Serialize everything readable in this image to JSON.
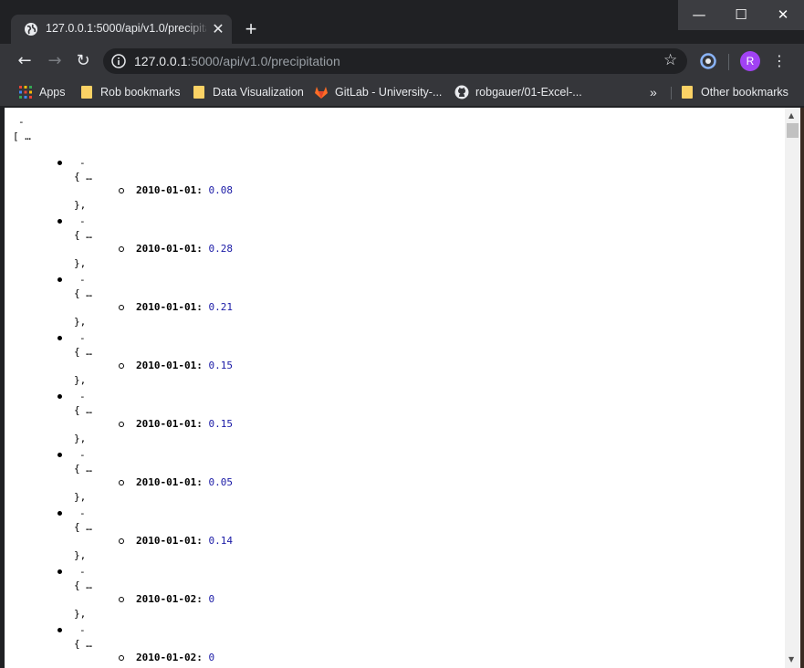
{
  "browser": {
    "tab": {
      "title": "127.0.0.1:5000/api/v1.0/precipitation",
      "close": "✕"
    },
    "new_tab": "+",
    "window": {
      "minimize": "—",
      "maximize": "☐",
      "close": "✕"
    },
    "nav": {
      "back": "←",
      "forward": "→",
      "reload": "↻"
    },
    "url": {
      "host": "127.0.0.1",
      "rest": ":5000/api/v1.0/precipitation"
    },
    "star": "☆",
    "avatar": "R",
    "menu": "⋮"
  },
  "bookmarks": {
    "items": [
      {
        "label": "Apps",
        "icon": "apps-grid-icon"
      },
      {
        "label": "Rob bookmarks",
        "icon": "folder-icon"
      },
      {
        "label": "Data Visualization",
        "icon": "folder-icon"
      },
      {
        "label": "GitLab - University-...",
        "icon": "gitlab-icon"
      },
      {
        "label": "robgauer/01-Excel-...",
        "icon": "github-icon"
      }
    ],
    "overflow": "»",
    "other": "Other bookmarks"
  },
  "colors": {
    "number": "#1a1aa6",
    "folder": "#fbd265",
    "avatar": "#a142f4"
  },
  "page": {
    "root_collapse": "-",
    "root_open": "[ …",
    "item_collapse": "-",
    "item_open": "{ …",
    "item_close": "},",
    "entries": [
      {
        "date": "2010-01-01",
        "value": "0.08"
      },
      {
        "date": "2010-01-01",
        "value": "0.28"
      },
      {
        "date": "2010-01-01",
        "value": "0.21"
      },
      {
        "date": "2010-01-01",
        "value": "0.15"
      },
      {
        "date": "2010-01-01",
        "value": "0.15"
      },
      {
        "date": "2010-01-01",
        "value": "0.05"
      },
      {
        "date": "2010-01-01",
        "value": "0.14"
      },
      {
        "date": "2010-01-02",
        "value": "0"
      },
      {
        "date": "2010-01-02",
        "value": "0"
      }
    ]
  }
}
